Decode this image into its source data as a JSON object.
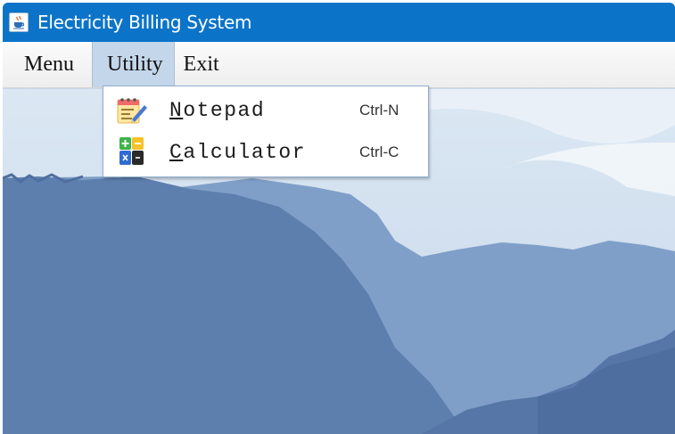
{
  "window": {
    "title": "Electricity Billing System",
    "icon": "java-coffee-cup-icon"
  },
  "menubar": {
    "items": [
      {
        "label": "Menu",
        "active": false
      },
      {
        "label": "Utility",
        "active": true
      },
      {
        "label": "Exit",
        "active": false
      }
    ]
  },
  "dropdown": {
    "items": [
      {
        "mnemonic": "N",
        "rest": "otepad",
        "shortcut": "Ctrl-N",
        "icon": "notepad-icon"
      },
      {
        "mnemonic": "C",
        "rest": "alculator",
        "shortcut": "Ctrl-C",
        "icon": "calculator-icon"
      }
    ]
  },
  "colors": {
    "titlebar": "#0b74c9",
    "menubar": "#f4f4f4",
    "active_menu": "#c4d6ea",
    "dropdown_border": "#93aed0"
  }
}
